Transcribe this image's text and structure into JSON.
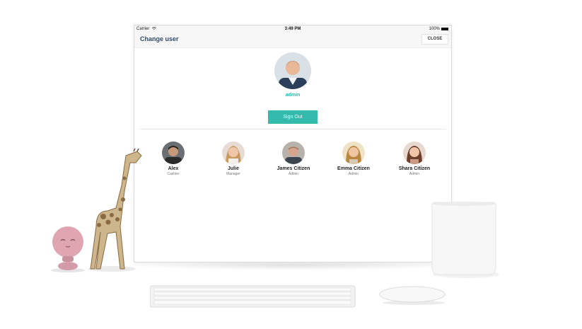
{
  "status_bar": {
    "carrier": "Carrier",
    "time": "3:49 PM",
    "battery": "100%"
  },
  "header": {
    "title": "Change user",
    "close_label": "CLOSE"
  },
  "current_user": {
    "name": "admin",
    "sign_out_label": "Sign Out"
  },
  "users": [
    {
      "name": "Alex",
      "role": "Cashier"
    },
    {
      "name": "Julie",
      "role": "Manager"
    },
    {
      "name": "James Citizen",
      "role": "Admin"
    },
    {
      "name": "Emma Citizen",
      "role": "Admin"
    },
    {
      "name": "Shara Citizen",
      "role": "Admin"
    }
  ],
  "colors": {
    "accent": "#34b9ad",
    "title": "#2f4b66"
  }
}
